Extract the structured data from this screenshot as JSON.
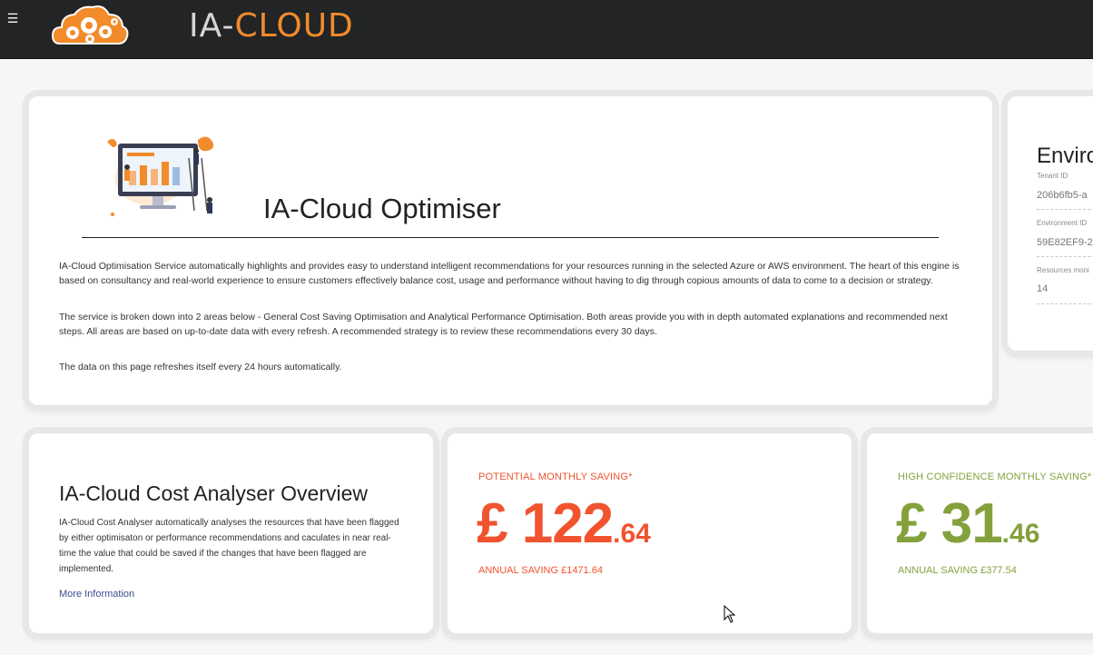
{
  "header": {
    "menu_icon": "hamburger-menu-icon",
    "logo_icon": "cloud-gears-logo-icon",
    "logo_text_ia": "IA-",
    "logo_text_cloud": "CLOUD",
    "accent_color": "#f28b2a"
  },
  "intro": {
    "illustration_icon": "monitor-dashboard-illustration",
    "title": "IA-Cloud Optimiser",
    "paragraphs": [
      "IA-Cloud Optimisation Service automatically highlights and provides easy to understand intelligent recommendations for your resources running in the selected Azure or AWS environment. The heart of this engine is based on consultancy and real-world experience to ensure customers effectively balance cost, usage and performance without having to dig through copious amounts of data to come to a decision or strategy.",
      "The service is broken down into 2 areas below - General Cost Saving Optimisation and Analytical Performance Optimisation. Both areas provide you with in depth automated explanations and recommended next steps. All areas are based on up-to-date data with every refresh. A recommended strategy is to review these recommendations every 30 days.",
      "The data on this page refreshes itself every 24 hours automatically."
    ]
  },
  "environment": {
    "title": "Enviro",
    "fields": [
      {
        "label": "Tenant ID",
        "value": "206b6fb5-a"
      },
      {
        "label": "Environment ID",
        "value": "59E82EF9-2"
      },
      {
        "label": "Resources moni",
        "value": "14"
      }
    ]
  },
  "overview": {
    "title": "IA-Cloud Cost Analyser Overview",
    "description": "IA-Cloud Cost Analyser automatically analyses the resources that have been flagged by either optimisaton or performance recommendations and caculates in near real-time the value that could be saved if the changes that have been flagged are implemented.",
    "link": "More Information"
  },
  "potential_saving": {
    "label": "POTENTIAL MONTHLY SAVING*",
    "amount_major": "£ 122",
    "amount_minor": ".64",
    "annual": "ANNUAL SAVING £1471.64",
    "color": "#f0532e"
  },
  "high_confidence_saving": {
    "label": "HIGH CONFIDENCE MONTHLY SAVING*",
    "amount_major": "£ 31",
    "amount_minor": ".46",
    "annual": "ANNUAL SAVING £377.54",
    "color": "#84a13c"
  },
  "cursor_icon": "mouse-pointer-icon"
}
